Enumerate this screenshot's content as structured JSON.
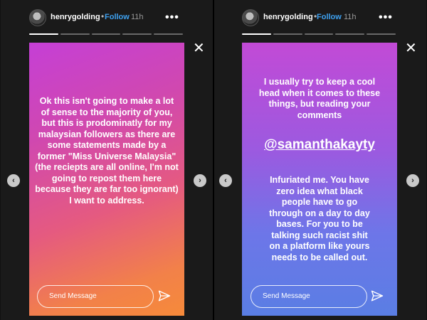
{
  "left": {
    "username": "henrygolding",
    "dot": "•",
    "follow": "Follow",
    "time": "11h",
    "more": "•••",
    "close": "✕",
    "story_text": "Ok this isn't going to make a lot of sense to the majority of you, but this is prodominatly for my malaysian followers as there are some statements made by a former \"Miss Universe Malaysia\" (the reciepts are all online, I'm not going to repost them here because they are far too ignorant) I want to address.",
    "send_placeholder": "Send Message",
    "prev_arrow": "‹",
    "next_arrow": "›"
  },
  "right": {
    "username": "henrygolding",
    "dot": "•",
    "follow": "Follow",
    "time": "11h",
    "more": "•••",
    "close": "✕",
    "story_text_top": "I usually try to keep a cool head when it comes to these things, but reading your comments",
    "mention": "@samanthakayty",
    "story_text_bottom": "Infuriated me. You have zero idea what black people have to go through on a day to day bases. For you to be talking such racist shit on a platform like yours needs to be called out.",
    "send_placeholder": "Send Message",
    "prev_arrow": "‹",
    "next_arrow": "›"
  }
}
